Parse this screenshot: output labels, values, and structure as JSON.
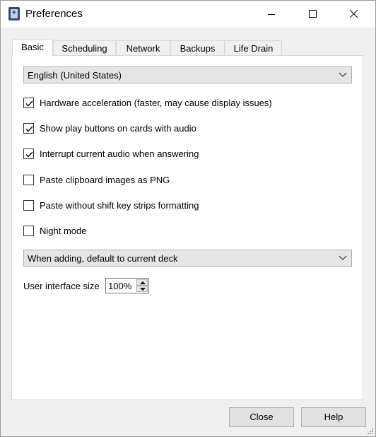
{
  "window": {
    "title": "Preferences"
  },
  "tabs": [
    {
      "label": "Basic",
      "active": true
    },
    {
      "label": "Scheduling",
      "active": false
    },
    {
      "label": "Network",
      "active": false
    },
    {
      "label": "Backups",
      "active": false
    },
    {
      "label": "Life Drain",
      "active": false
    }
  ],
  "basic": {
    "language_select": {
      "value": "English (United States)"
    },
    "checkboxes": [
      {
        "label": "Hardware acceleration (faster, may cause display issues)",
        "checked": true
      },
      {
        "label": "Show play buttons on cards with audio",
        "checked": true
      },
      {
        "label": "Interrupt current audio when answering",
        "checked": true
      },
      {
        "label": "Paste clipboard images as PNG",
        "checked": false
      },
      {
        "label": "Paste without shift key strips formatting",
        "checked": false
      },
      {
        "label": "Night mode",
        "checked": false
      }
    ],
    "deck_select": {
      "value": "When adding, default to current deck"
    },
    "ui_size": {
      "label": "User interface size",
      "value": "100%"
    }
  },
  "buttons": {
    "close_label": "Close",
    "help_label": "Help"
  },
  "colors": {
    "window_bg": "#f0f0f0",
    "panel_bg": "#ffffff",
    "button_bg": "#e1e1e1",
    "border": "#adadad"
  }
}
